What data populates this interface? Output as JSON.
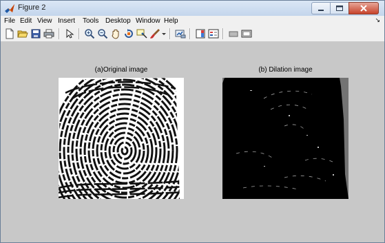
{
  "window": {
    "title": "Figure 2",
    "controls": [
      "minimize",
      "maximize",
      "close"
    ]
  },
  "menu": {
    "items": [
      "File",
      "Edit",
      "View",
      "Insert",
      "Tools",
      "Desktop",
      "Window",
      "Help"
    ],
    "dock_arrow": "↘"
  },
  "toolbar": {
    "icons": [
      "new-figure-icon",
      "open-file-icon",
      "save-icon",
      "print-icon",
      "edit-plot-arrow-icon",
      "zoom-in-icon",
      "zoom-out-icon",
      "pan-hand-icon",
      "rotate-3d-icon",
      "data-cursor-icon",
      "brush-icon",
      "dropdown-arrow-icon",
      "link-plot-icon",
      "colorbar-icon",
      "legend-icon",
      "hide-plot-tools-icon",
      "show-plot-tools-icon"
    ]
  },
  "figure": {
    "left_title": "(a)Original image",
    "right_title": "(b) Dilation image"
  }
}
